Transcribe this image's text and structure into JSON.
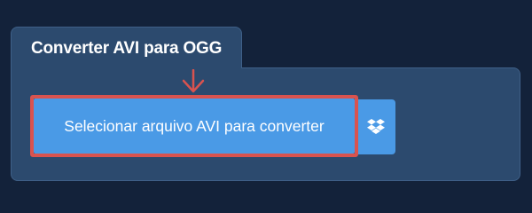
{
  "converter": {
    "title": "Converter AVI para OGG",
    "select_button_label": "Selecionar arquivo AVI para converter",
    "dropbox_icon": "dropbox-icon",
    "arrow_icon": "arrow-down-icon"
  },
  "colors": {
    "background": "#13223a",
    "panel": "#2c4a6e",
    "button": "#4a9ae6",
    "highlight": "#d9534f"
  }
}
